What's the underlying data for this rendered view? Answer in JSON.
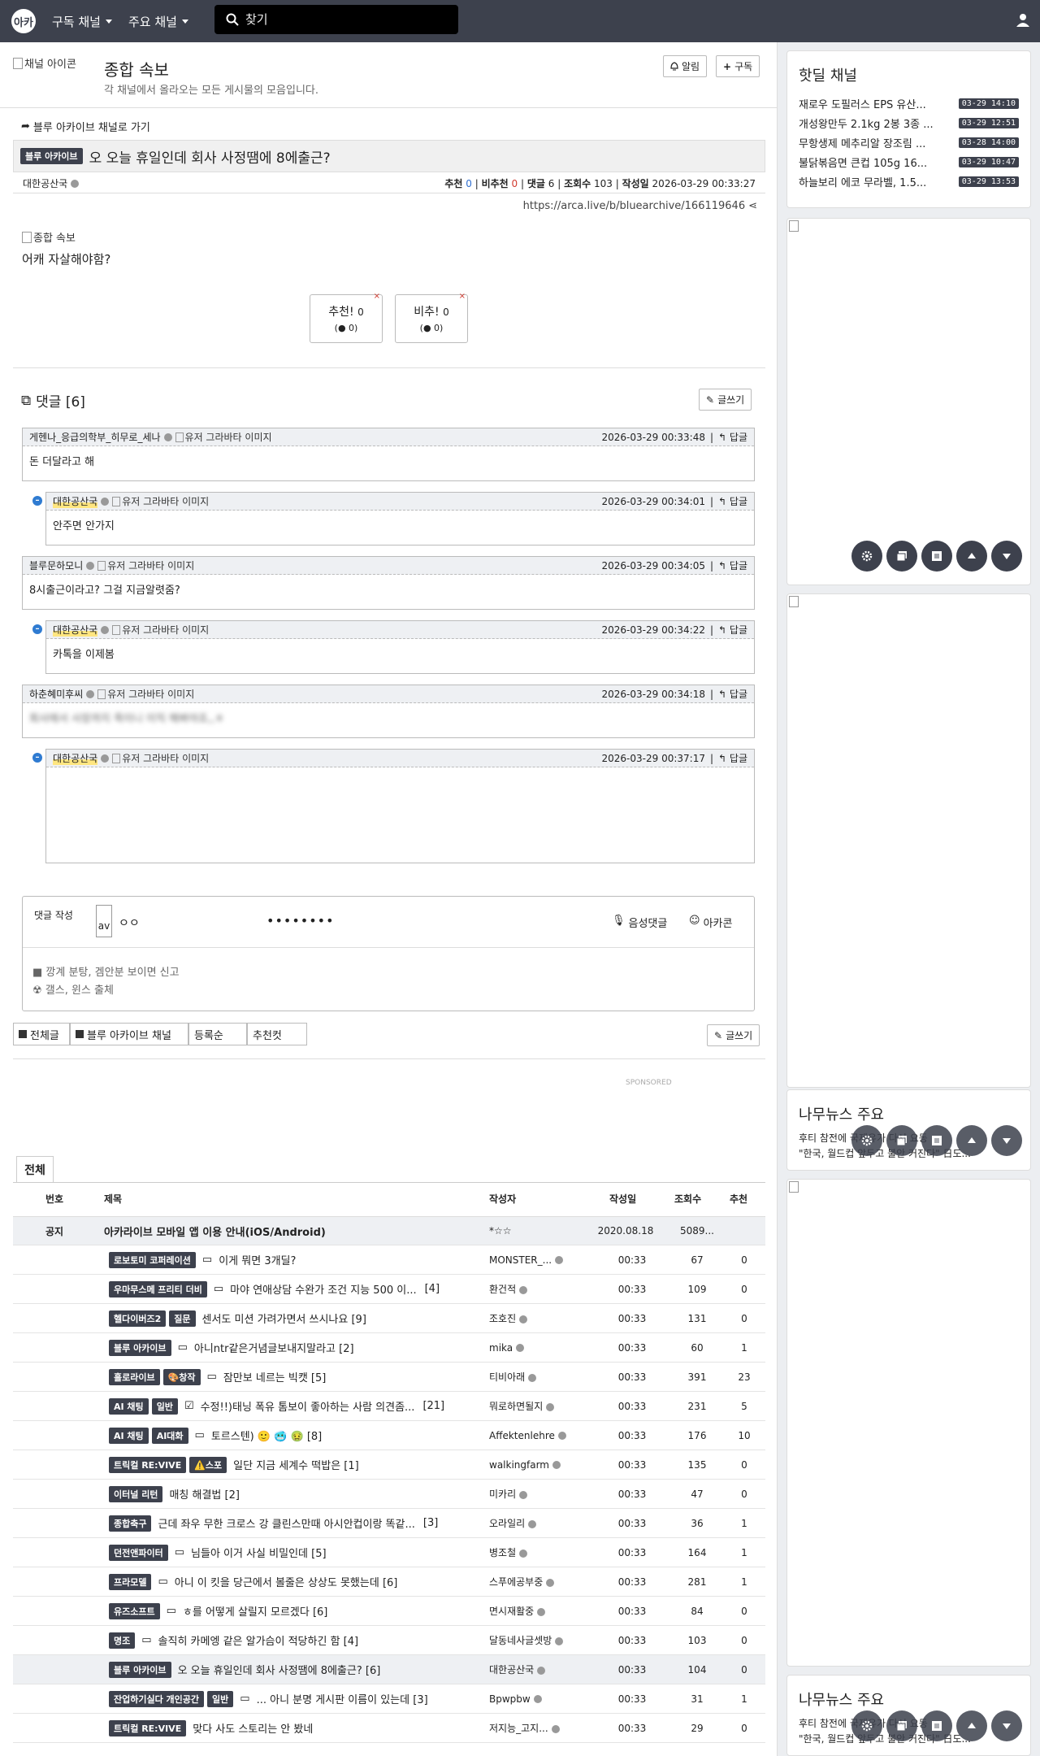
{
  "nav": {
    "logo": "아카",
    "menu1": "구독 채널",
    "menu2": "주요 채널",
    "search_placeholder": "찾기"
  },
  "channel": {
    "icon_alt": "채널 아이콘",
    "title": "종합 속보",
    "desc": "각 채널에서 올라오는 모든 게시물의 모음입니다.",
    "alarm": "알림",
    "subscribe": "구독"
  },
  "post": {
    "back_link": "블루 아카이브 채널로 가기",
    "category": "블루 아카이브",
    "title": "오 오늘 휴일인데 회사 사정땜에 8에출근?",
    "author": "대한공산국",
    "rec_label": "추천",
    "rec": "0",
    "unrec_label": "비추천",
    "unrec": "0",
    "comments_label": "댓글",
    "comments": "6",
    "views_label": "조회수",
    "views": "103",
    "date_label": "작성일",
    "date": "2026-03-29 00:33:27",
    "url": "https://arca.live/b/bluearchive/166119646",
    "image_alt": "종합 속보",
    "body": "어캐 자살해야함?",
    "up_btn": "추천!",
    "up_count": "0",
    "up_sub": "0",
    "down_btn": "비추!",
    "down_count": "0",
    "down_sub": "0"
  },
  "comments": {
    "header": "댓글 [6]",
    "write": "글쓰기",
    "reply": "답글",
    "avatar_alt": "유저 그라바타 이미지",
    "items": [
      {
        "author": "게헨나_응급의학부_히무로_세나",
        "date": "2026-03-29 00:33:48",
        "text": "돈 더달라고 해"
      },
      {
        "author": "대한공산국",
        "date": "2026-03-29 00:34:01",
        "text": "안주면 안가지"
      },
      {
        "author": "블루문하모니",
        "date": "2026-03-29 00:34:05",
        "text": "8시출근이라고? 그걸 지금알렷줌?"
      },
      {
        "author": "대한공산국",
        "date": "2026-03-29 00:34:22",
        "text": "카톡을 이제봄"
      },
      {
        "author": "하춘혜미후씨",
        "date": "2026-03-29 00:34:18",
        "text": "회사에서 사장까지 죽이니 이직 해봐야죠,,ㅎ"
      },
      {
        "author": "대한공산국",
        "date": "2026-03-29 00:37:17",
        "text": ""
      }
    ]
  },
  "compose": {
    "label": "댓글 작성",
    "avatar": "av",
    "name": "ㅇㅇ",
    "password": "••••••••",
    "voice": "음성댓글",
    "arcacon": "아카콘",
    "rule1": "■ 깡계 분탕, 겜안분 보이면 신고",
    "rule2": "☢ 갤스, 윈스 출체"
  },
  "board": {
    "tab_all": "전체글",
    "tab_channel": "블루 아카이브 채널",
    "tab_order": "등록순",
    "tab_best": "추천컷",
    "write": "글쓰기",
    "sponsored": "SPONSORED",
    "section_tab": "전체",
    "headers": [
      "번호",
      "제목",
      "작성자",
      "작성일",
      "조회수",
      "추천"
    ],
    "notice": {
      "num": "공지",
      "title": "아카라이브 모바일 앱 이용 안내(iOS/Android)",
      "author": "*☆☆",
      "date": "2020.08.18",
      "views": "5089...",
      "rec": ""
    },
    "rows": [
      {
        "cats": [
          "로보토미 코퍼레이션"
        ],
        "icon": "▭",
        "title": "이게 뭐면 3개딜?",
        "cnt": "",
        "author": "MONSTER_...",
        "date": "00:33",
        "views": "67",
        "rec": "0"
      },
      {
        "cats": [
          "우마무스메 프리티 더비"
        ],
        "icon": "▭",
        "title": "마야 연애상담 수완가 조건 지능 500 이...",
        "cnt": "[4]",
        "author": "환건적",
        "date": "00:33",
        "views": "109",
        "rec": "0"
      },
      {
        "cats": [
          "헬다이버즈2",
          "질문"
        ],
        "icon": "",
        "title": "센서도 미션 가려가면서 쓰시나요 [9]",
        "cnt": "",
        "author": "조호진",
        "date": "00:33",
        "views": "131",
        "rec": "0"
      },
      {
        "cats": [
          "블루 아카이브"
        ],
        "icon": "▭",
        "title": "아니ntr같은거념글보내지말라고 [2]",
        "cnt": "",
        "author": "mika",
        "date": "00:33",
        "views": "60",
        "rec": "1"
      },
      {
        "cats": [
          "홀로라이브",
          "🎨창작"
        ],
        "icon": "▭",
        "title": "잠만보 네르는 빅캣 [5]",
        "cnt": "",
        "author": "티비아래",
        "date": "00:33",
        "views": "391",
        "rec": "23"
      },
      {
        "cats": [
          "AI 채팅",
          "일반"
        ],
        "icon": "☑",
        "title": "수정!!)태닝 폭유 톰보이 좋아하는 사람 의견좀...",
        "cnt": "[21]",
        "author": "뭐로하면될지",
        "date": "00:33",
        "views": "231",
        "rec": "5"
      },
      {
        "cats": [
          "AI 채팅",
          "AI대화"
        ],
        "icon": "▭",
        "title": "토르스텐) 🙂 🥶 🤢 [8]",
        "cnt": "",
        "author": "Affektenlehre",
        "date": "00:33",
        "views": "176",
        "rec": "10"
      },
      {
        "cats": [
          "트릭컬 RE:VIVE",
          "⚠️스포"
        ],
        "icon": "",
        "title": "일단 지금 세계수 떡밥은 [1]",
        "cnt": "",
        "author": "walkingfarm",
        "date": "00:33",
        "views": "135",
        "rec": "0"
      },
      {
        "cats": [
          "이터널 리턴"
        ],
        "icon": "",
        "title": "매칭 해결법 [2]",
        "cnt": "",
        "author": "미카리",
        "date": "00:33",
        "views": "47",
        "rec": "0"
      },
      {
        "cats": [
          "종합축구"
        ],
        "icon": "",
        "title": "근데 좌우 무한 크로스 강 클린스만때 아시안컵이랑 똑같...",
        "cnt": "[3]",
        "author": "오라일리",
        "date": "00:33",
        "views": "36",
        "rec": "1"
      },
      {
        "cats": [
          "던전앤파이터"
        ],
        "icon": "▭",
        "title": "님들아 이거 사실 비밀인데 [5]",
        "cnt": "",
        "author": "병조철",
        "date": "00:33",
        "views": "164",
        "rec": "1"
      },
      {
        "cats": [
          "프라모델"
        ],
        "icon": "▭",
        "title": "아니 이 킷을 당근에서 볼줄은 상상도 못했는데 [6]",
        "cnt": "",
        "author": "스푸에공부중",
        "date": "00:33",
        "views": "281",
        "rec": "1"
      },
      {
        "cats": [
          "유즈소프트"
        ],
        "icon": "▭",
        "title": "ㅎ를 어떻게 살릴지 모르겠다 [6]",
        "cnt": "",
        "author": "면시재활중",
        "date": "00:33",
        "views": "84",
        "rec": "0"
      },
      {
        "cats": [
          "명조"
        ],
        "icon": "▭",
        "title": "솔직히 카메엥 같은 알가슴이 적당하긴 함 [4]",
        "cnt": "",
        "author": "달동네사글셋방",
        "date": "00:33",
        "views": "103",
        "rec": "0"
      },
      {
        "cats": [
          "블루 아카이브"
        ],
        "icon": "",
        "title": "오 오늘 휴일인데 회사 사정땜에 8에출근? [6]",
        "cnt": "",
        "author": "대한공산국",
        "date": "00:33",
        "views": "104",
        "rec": "0"
      },
      {
        "cats": [
          "잔업하기실다 개인공간",
          "일반"
        ],
        "icon": "▭",
        "title": "... 아니 분명 게시판 이름이 있는데 [3]",
        "cnt": "",
        "author": "Bpwpbw",
        "date": "00:33",
        "views": "31",
        "rec": "1"
      },
      {
        "cats": [
          "트릭컬 RE:VIVE"
        ],
        "icon": "",
        "title": "맞다 사도 스토리는 안 봤네",
        "cnt": "",
        "author": "저지능_고지...",
        "date": "00:33",
        "views": "29",
        "rec": "0"
      }
    ]
  },
  "sidebar": {
    "hot_title": "핫딜 채널",
    "hot": [
      {
        "title": "재로우 도필러스 EPS 유산...",
        "date": "03-29 14:10"
      },
      {
        "title": "개성왕만두 2.1kg 2봉 3종 ...",
        "date": "03-29 12:51"
      },
      {
        "title": "무항생제 메추리알 장조림 ...",
        "date": "03-28 14:00"
      },
      {
        "title": "불닭볶음면 큰컵 105g 16...",
        "date": "03-29 10:47"
      },
      {
        "title": "하늘보리 에코 무라벨, 1.5...",
        "date": "03-29 13:53"
      }
    ],
    "news_title": "나무뉴스 주요",
    "news1": "후티 참전에 국제유가 다시 요동",
    "news2": "\"한국, 월드컵 앞두고 불안 커진다\" 日도..."
  }
}
